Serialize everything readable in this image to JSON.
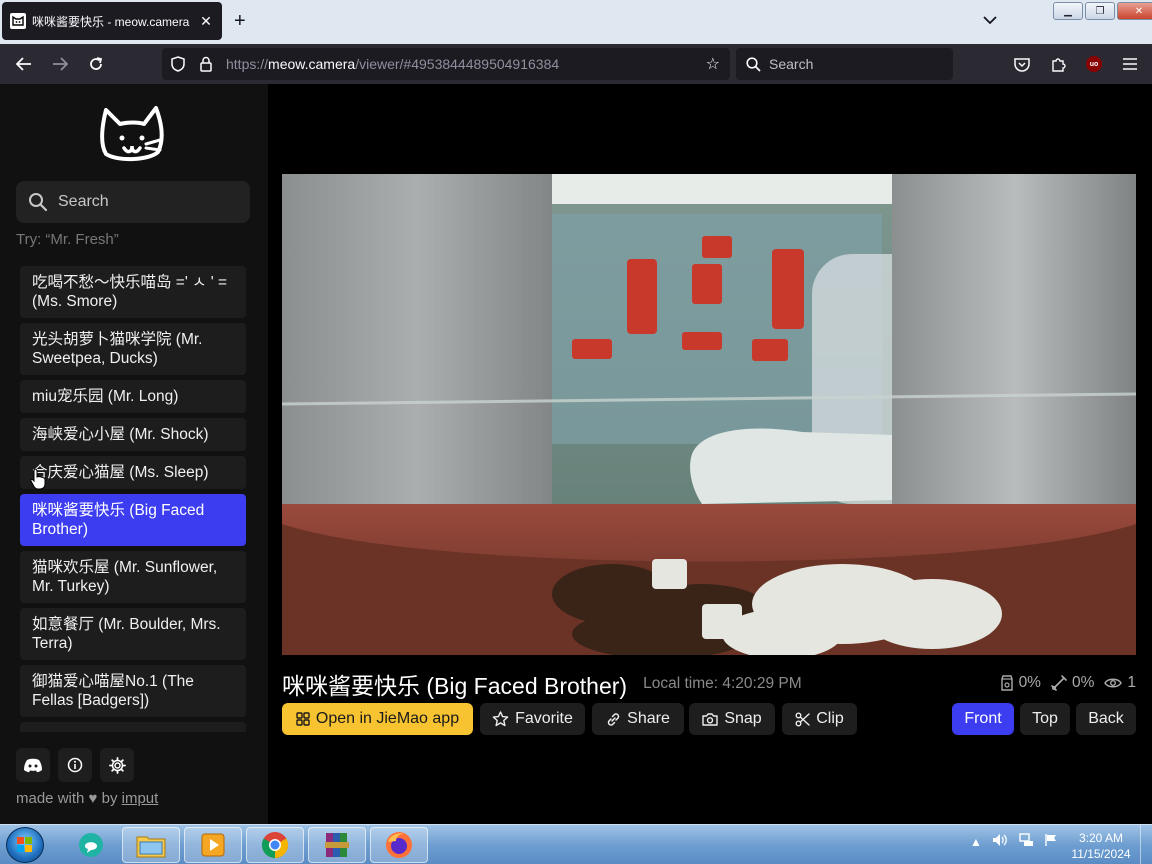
{
  "browser": {
    "tab_title": "咪咪酱要快乐 - meow.camera",
    "url_prefix": "https://",
    "url_host": "meow.camera",
    "url_path": "/viewer/#4953844489504916384",
    "search_placeholder": "Search",
    "ublock_label": "uo"
  },
  "sidebar": {
    "search_placeholder": "Search",
    "hint": "Try: “Mr. Fresh”",
    "cameras": [
      {
        "label": "吃喝不愁～快乐喵岛 =' ㅅ ' = (Ms. Smore)"
      },
      {
        "label": "光头胡萝卜猫咪学院 (Mr. Sweetpea, Ducks)"
      },
      {
        "label": "miu宠乐园 (Mr. Long)"
      },
      {
        "label": "海峡爱心小屋 (Mr. Shock)"
      },
      {
        "label": "合庆爱心猫屋 (Ms. Sleep)"
      },
      {
        "label": "咪咪酱要快乐 (Big Faced Brother)",
        "active": true
      },
      {
        "label": "猫咪欢乐屋 (Mr. Sunflower, Mr. Turkey)"
      },
      {
        "label": "如意餐厅 (Mr. Boulder, Mrs. Terra)"
      },
      {
        "label": "御猫爱心喵屋No.1 (The Fellas [Badgers])"
      }
    ],
    "made_with_prefix": "made with",
    "made_with_by": "by",
    "made_with_author": "imput"
  },
  "viewer": {
    "title": "咪咪酱要快乐 (Big Faced Brother)",
    "local_time": "Local time: 4:20:29 PM",
    "food_level": "0%",
    "treat_level": "0%",
    "viewers": "1",
    "buttons": {
      "open_app": "Open in JieMao app",
      "favorite": "Favorite",
      "share": "Share",
      "snap": "Snap",
      "clip": "Clip",
      "front": "Front",
      "top": "Top",
      "back": "Back"
    }
  },
  "taskbar": {
    "time": "3:20 AM",
    "date": "11/15/2024"
  },
  "colors": {
    "accent_blue": "#3c3cf0",
    "accent_yellow": "#f7c331"
  }
}
